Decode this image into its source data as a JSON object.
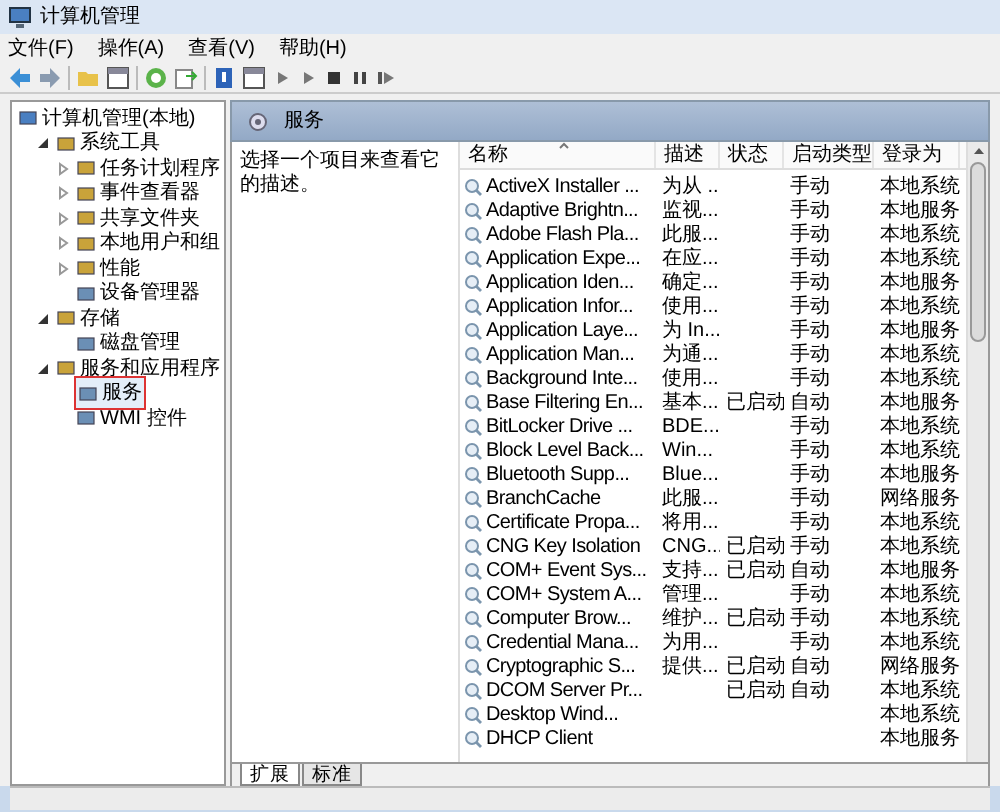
{
  "window": {
    "title": "计算机管理"
  },
  "menu": [
    "文件(F)",
    "操作(A)",
    "查看(V)",
    "帮助(H)"
  ],
  "tree": [
    {
      "label": "计算机管理(本地)",
      "kind": "root",
      "selected": false,
      "children": [
        {
          "label": "系统工具",
          "kind": "folder",
          "expanded": true,
          "selected": false,
          "children": [
            {
              "label": "任务计划程序",
              "kind": "folder",
              "expanded": false,
              "selected": false
            },
            {
              "label": "事件查看器",
              "kind": "folder",
              "expanded": false,
              "selected": false
            },
            {
              "label": "共享文件夹",
              "kind": "folder",
              "expanded": false,
              "selected": false
            },
            {
              "label": "本地用户和组",
              "kind": "folder",
              "expanded": false,
              "selected": false
            },
            {
              "label": "性能",
              "kind": "folder",
              "expanded": false,
              "selected": false
            },
            {
              "label": "设备管理器",
              "kind": "leaf",
              "selected": false
            }
          ]
        },
        {
          "label": "存储",
          "kind": "folder",
          "expanded": true,
          "selected": false,
          "children": [
            {
              "label": "磁盘管理",
              "kind": "leaf",
              "selected": false
            }
          ]
        },
        {
          "label": "服务和应用程序",
          "kind": "folder",
          "expanded": true,
          "selected": false,
          "children": [
            {
              "label": "服务",
              "kind": "leaf",
              "selected": true
            },
            {
              "label": "WMI 控件",
              "kind": "leaf",
              "selected": false
            }
          ]
        }
      ]
    }
  ],
  "panel": {
    "title": "服务",
    "description": "选择一个项目来查看它的描述。"
  },
  "table": {
    "columns": [
      {
        "label": "名称",
        "sorted": true
      },
      {
        "label": "描述",
        "sorted": false
      },
      {
        "label": "状态",
        "sorted": false
      },
      {
        "label": "启动类型",
        "sorted": false
      },
      {
        "label": "登录为",
        "sorted": false
      }
    ],
    "rows": [
      [
        "ActiveX Installer ...",
        "为从 ...",
        "",
        "手动",
        "本地系统"
      ],
      [
        "Adaptive Brightn...",
        "监视...",
        "",
        "手动",
        "本地服务"
      ],
      [
        "Adobe Flash Pla...",
        "此服...",
        "",
        "手动",
        "本地系统"
      ],
      [
        "Application Expe...",
        "在应...",
        "",
        "手动",
        "本地系统"
      ],
      [
        "Application Iden...",
        "确定...",
        "",
        "手动",
        "本地服务"
      ],
      [
        "Application Infor...",
        "使用...",
        "",
        "手动",
        "本地系统"
      ],
      [
        "Application Laye...",
        "为 In...",
        "",
        "手动",
        "本地服务"
      ],
      [
        "Application Man...",
        "为通...",
        "",
        "手动",
        "本地系统"
      ],
      [
        "Background Inte...",
        "使用...",
        "",
        "手动",
        "本地系统"
      ],
      [
        "Base Filtering En...",
        "基本...",
        "已启动",
        "自动",
        "本地服务"
      ],
      [
        "BitLocker Drive ...",
        "BDE...",
        "",
        "手动",
        "本地系统"
      ],
      [
        "Block Level Back...",
        "Win...",
        "",
        "手动",
        "本地系统"
      ],
      [
        "Bluetooth Supp...",
        "Blue...",
        "",
        "手动",
        "本地服务"
      ],
      [
        "BranchCache",
        "此服...",
        "",
        "手动",
        "网络服务"
      ],
      [
        "Certificate Propa...",
        "将用...",
        "",
        "手动",
        "本地系统"
      ],
      [
        "CNG Key Isolation",
        "CNG...",
        "已启动",
        "手动",
        "本地系统"
      ],
      [
        "COM+ Event Sys...",
        "支持...",
        "已启动",
        "自动",
        "本地服务"
      ],
      [
        "COM+ System A...",
        "管理...",
        "",
        "手动",
        "本地系统"
      ],
      [
        "Computer Brow...",
        "维护...",
        "已启动",
        "手动",
        "本地系统"
      ],
      [
        "Credential Mana...",
        "为用...",
        "",
        "手动",
        "本地系统"
      ],
      [
        "Cryptographic S...",
        "提供...",
        "已启动",
        "自动",
        "网络服务"
      ],
      [
        "DCOM Server Pr...",
        "",
        "已启动",
        "自动",
        "本地系统"
      ],
      [
        "Desktop Wind...",
        "",
        "",
        "",
        "本地系统"
      ],
      [
        "DHCP Client",
        "",
        "",
        "",
        "本地服务"
      ]
    ]
  },
  "bottom_tabs": [
    {
      "label": "扩展",
      "selected": true
    },
    {
      "label": "标准",
      "selected": false
    }
  ]
}
